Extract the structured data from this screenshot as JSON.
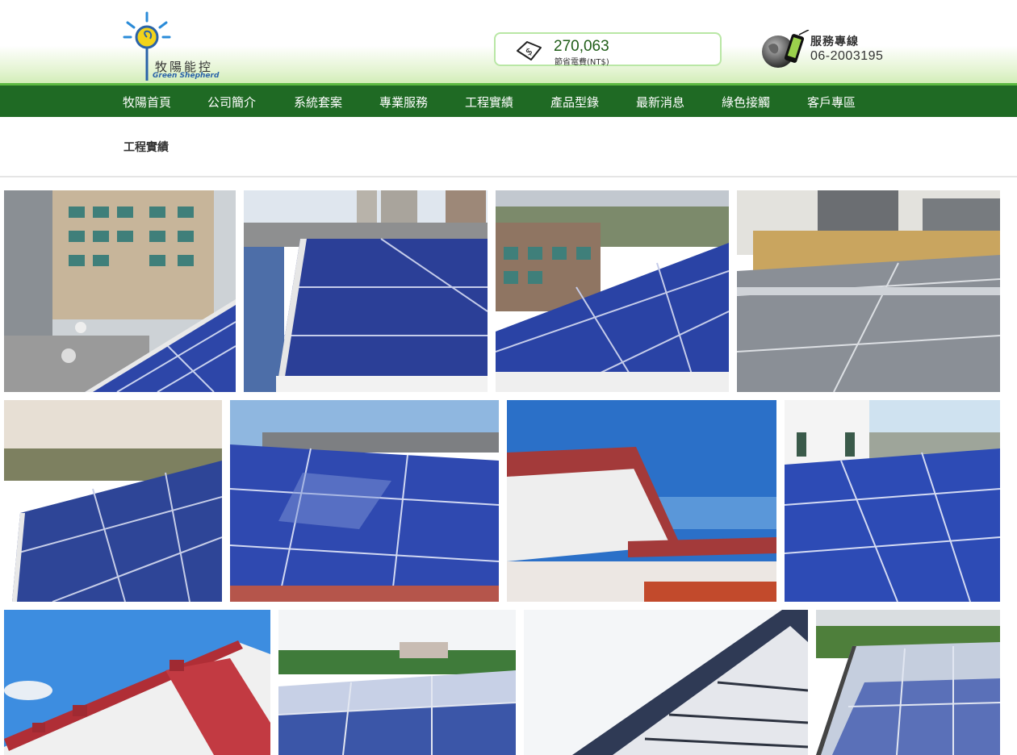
{
  "brand": {
    "name_cn": "牧陽能控",
    "name_en": "Green Shepherd"
  },
  "savings": {
    "value": "270,063",
    "label": "節省電費(NT$)"
  },
  "service": {
    "title": "服務專線",
    "phone": "06-2003195"
  },
  "nav": [
    {
      "label": "牧陽首頁"
    },
    {
      "label": "公司簡介"
    },
    {
      "label": "系統套案"
    },
    {
      "label": "專業服務"
    },
    {
      "label": "工程實績"
    },
    {
      "label": "產品型錄"
    },
    {
      "label": "最新消息"
    },
    {
      "label": "綠色接觸"
    },
    {
      "label": "客戶專區"
    }
  ],
  "page": {
    "title": "工程實績"
  },
  "colors": {
    "nav_green": "#1f6a24",
    "nav_accent": "#5cb941",
    "counter_border": "#b9e7a5",
    "counter_text": "#1f5d17",
    "panel_blue": "#26399a"
  },
  "gallery": {
    "photo_count": 12
  }
}
